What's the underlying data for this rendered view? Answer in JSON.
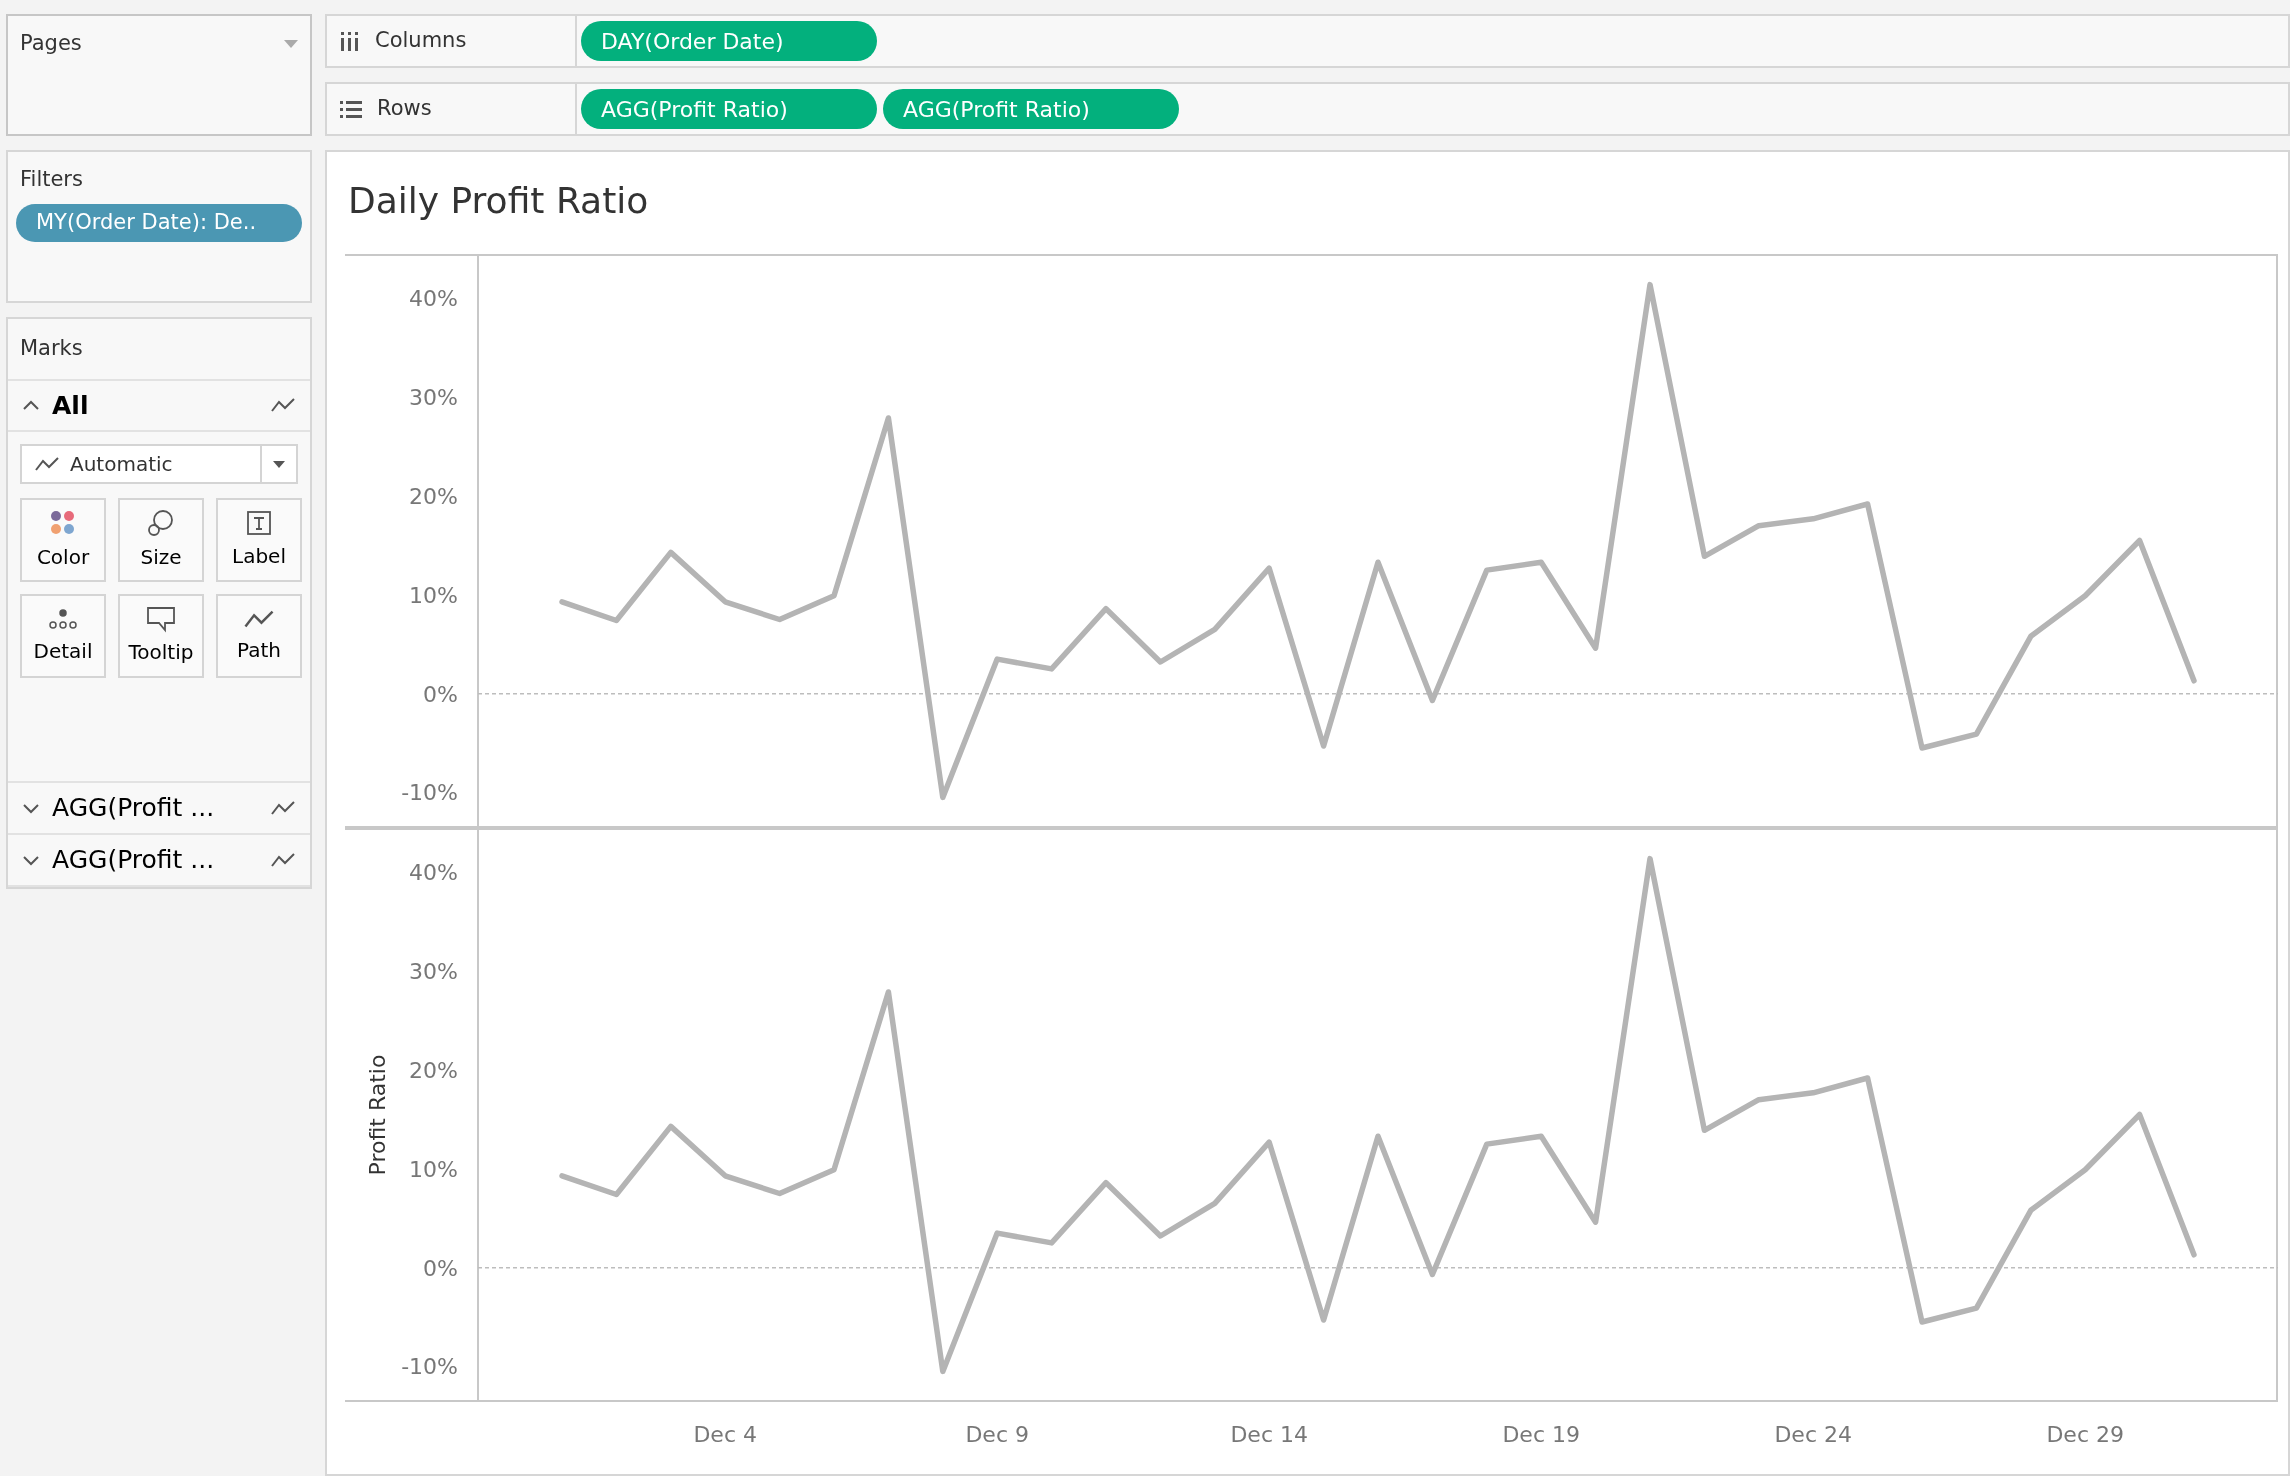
{
  "pages_card": {
    "title": "Pages"
  },
  "filters_card": {
    "title": "Filters",
    "pills": [
      "MY(Order Date): De.."
    ]
  },
  "marks_card": {
    "title": "Marks",
    "mark_type": "Automatic",
    "layers": [
      {
        "label": "All",
        "expanded": true
      },
      {
        "label": "AGG(Profit ...",
        "expanded": false
      },
      {
        "label": "AGG(Profit ...",
        "expanded": false
      }
    ],
    "buttons": [
      {
        "kind": "color",
        "label": "Color"
      },
      {
        "kind": "size",
        "label": "Size"
      },
      {
        "kind": "label",
        "label": "Label"
      },
      {
        "kind": "detail",
        "label": "Detail"
      },
      {
        "kind": "tooltip",
        "label": "Tooltip"
      },
      {
        "kind": "path",
        "label": "Path"
      }
    ]
  },
  "shelves": [
    {
      "kind": "columns",
      "label": "Columns",
      "pills": [
        "DAY(Order Date)"
      ]
    },
    {
      "kind": "rows",
      "label": "Rows",
      "pills": [
        "AGG(Profit Ratio)",
        "AGG(Profit Ratio)"
      ]
    }
  ],
  "view": {
    "title": "Daily Profit Ratio",
    "panes": [
      {
        "chart_data": {
          "type": "line",
          "ylim": [
            -13.5,
            44.4
          ],
          "yticks": [
            {
              "value": -10,
              "label": "-10%"
            },
            {
              "value": 0,
              "label": "0%"
            },
            {
              "value": 10,
              "label": "10%"
            },
            {
              "value": 20,
              "label": "20%"
            },
            {
              "value": 30,
              "label": "30%"
            },
            {
              "value": 40,
              "label": "40%"
            }
          ],
          "series": [
            {
              "color": "#b4b4b4",
              "values": [
                9.3,
                7.4,
                14.3,
                9.3,
                7.5,
                9.9,
                27.9,
                -10.5,
                3.5,
                2.5,
                8.6,
                3.2,
                6.5,
                12.7,
                -5.3,
                13.3,
                -0.7,
                12.5,
                13.3,
                4.6,
                41.4,
                13.9,
                17.0,
                17.7,
                19.2,
                -5.5,
                -4.1,
                5.8,
                9.9,
                15.5,
                1.3
              ]
            }
          ]
        }
      },
      {
        "chart_data": {
          "type": "line",
          "ylabel": "Profit Ratio",
          "categories": [
            null,
            null,
            null,
            "Dec 4",
            null,
            null,
            null,
            null,
            "Dec 9",
            null,
            null,
            null,
            null,
            "Dec 14",
            null,
            null,
            null,
            null,
            "Dec 19",
            null,
            null,
            null,
            null,
            "Dec 24",
            null,
            null,
            null,
            null,
            "Dec 29",
            null,
            null
          ],
          "ylim": [
            -13.5,
            44.4
          ],
          "yticks": [
            {
              "value": -10,
              "label": "-10%"
            },
            {
              "value": 0,
              "label": "0%"
            },
            {
              "value": 10,
              "label": "10%"
            },
            {
              "value": 20,
              "label": "20%"
            },
            {
              "value": 30,
              "label": "30%"
            },
            {
              "value": 40,
              "label": "40%"
            }
          ],
          "series": [
            {
              "color": "#b4b4b4",
              "values": [
                9.3,
                7.4,
                14.3,
                9.3,
                7.5,
                9.9,
                27.9,
                -10.5,
                3.5,
                2.5,
                8.6,
                3.2,
                6.5,
                12.7,
                -5.3,
                13.3,
                -0.7,
                12.5,
                13.3,
                4.6,
                41.4,
                13.9,
                17.0,
                17.7,
                19.2,
                -5.5,
                -4.1,
                5.8,
                9.9,
                15.5,
                1.3
              ]
            }
          ]
        }
      }
    ]
  }
}
